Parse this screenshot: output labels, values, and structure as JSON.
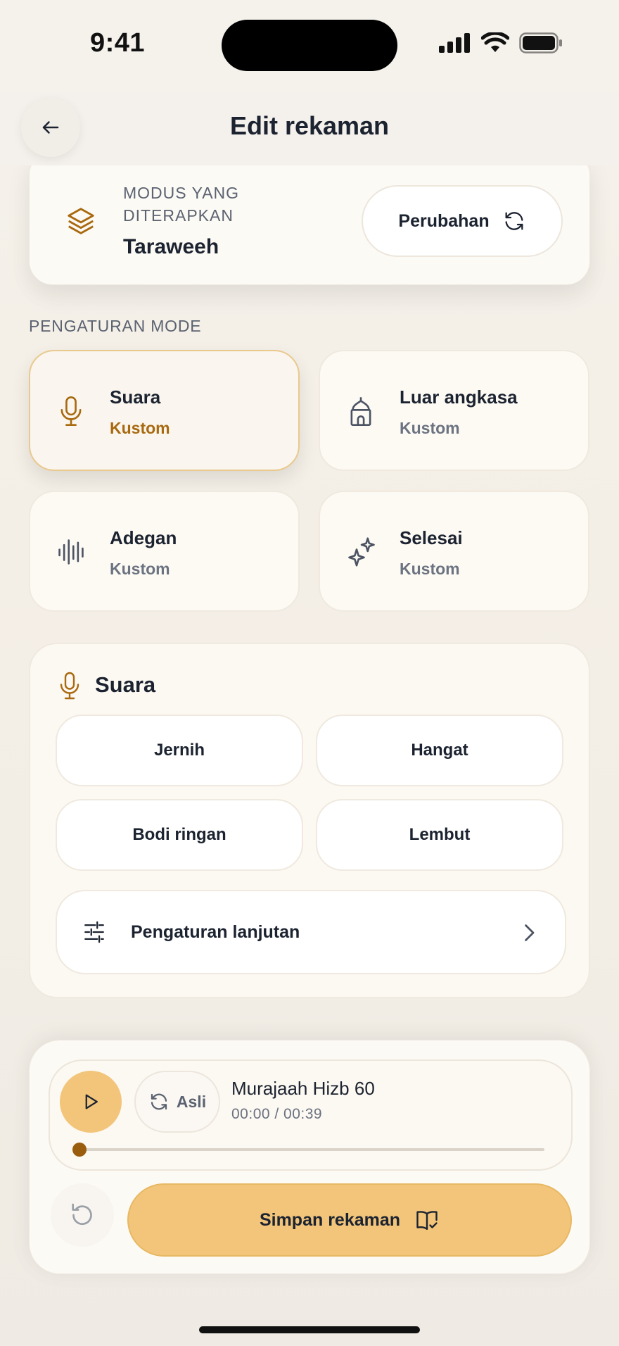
{
  "status": {
    "time": "9:41"
  },
  "header": {
    "title": "Edit rekaman",
    "back_icon": "arrow-left-icon"
  },
  "applied_mode": {
    "label": "MODUS YANG DITERAPKAN",
    "value": "Taraweeh",
    "change_label": "Perubahan",
    "icon": "layers-icon",
    "accent": "#a8690f"
  },
  "settings": {
    "section_label": "PENGATURAN MODE",
    "tiles": [
      {
        "name": "Suara",
        "sub": "Kustom",
        "icon": "microphone-icon",
        "active": true
      },
      {
        "name": "Luar angkasa",
        "sub": "Kustom",
        "icon": "mosque-icon",
        "active": false
      },
      {
        "name": "Adegan",
        "sub": "Kustom",
        "icon": "waveform-icon",
        "active": false
      },
      {
        "name": "Selesai",
        "sub": "Kustom",
        "icon": "sparkle-icon",
        "active": false
      }
    ]
  },
  "voice_panel": {
    "title": "Suara",
    "options": [
      "Jernih",
      "Hangat",
      "Bodi ringan",
      "Lembut"
    ],
    "advanced_label": "Pengaturan lanjutan"
  },
  "player": {
    "original_label": "Asli",
    "track_title": "Murajaah Hizb 60",
    "time_display": "00:00 / 00:39",
    "progress": 0.0,
    "save_label": "Simpan rekaman",
    "accent": "#f2c57a"
  }
}
